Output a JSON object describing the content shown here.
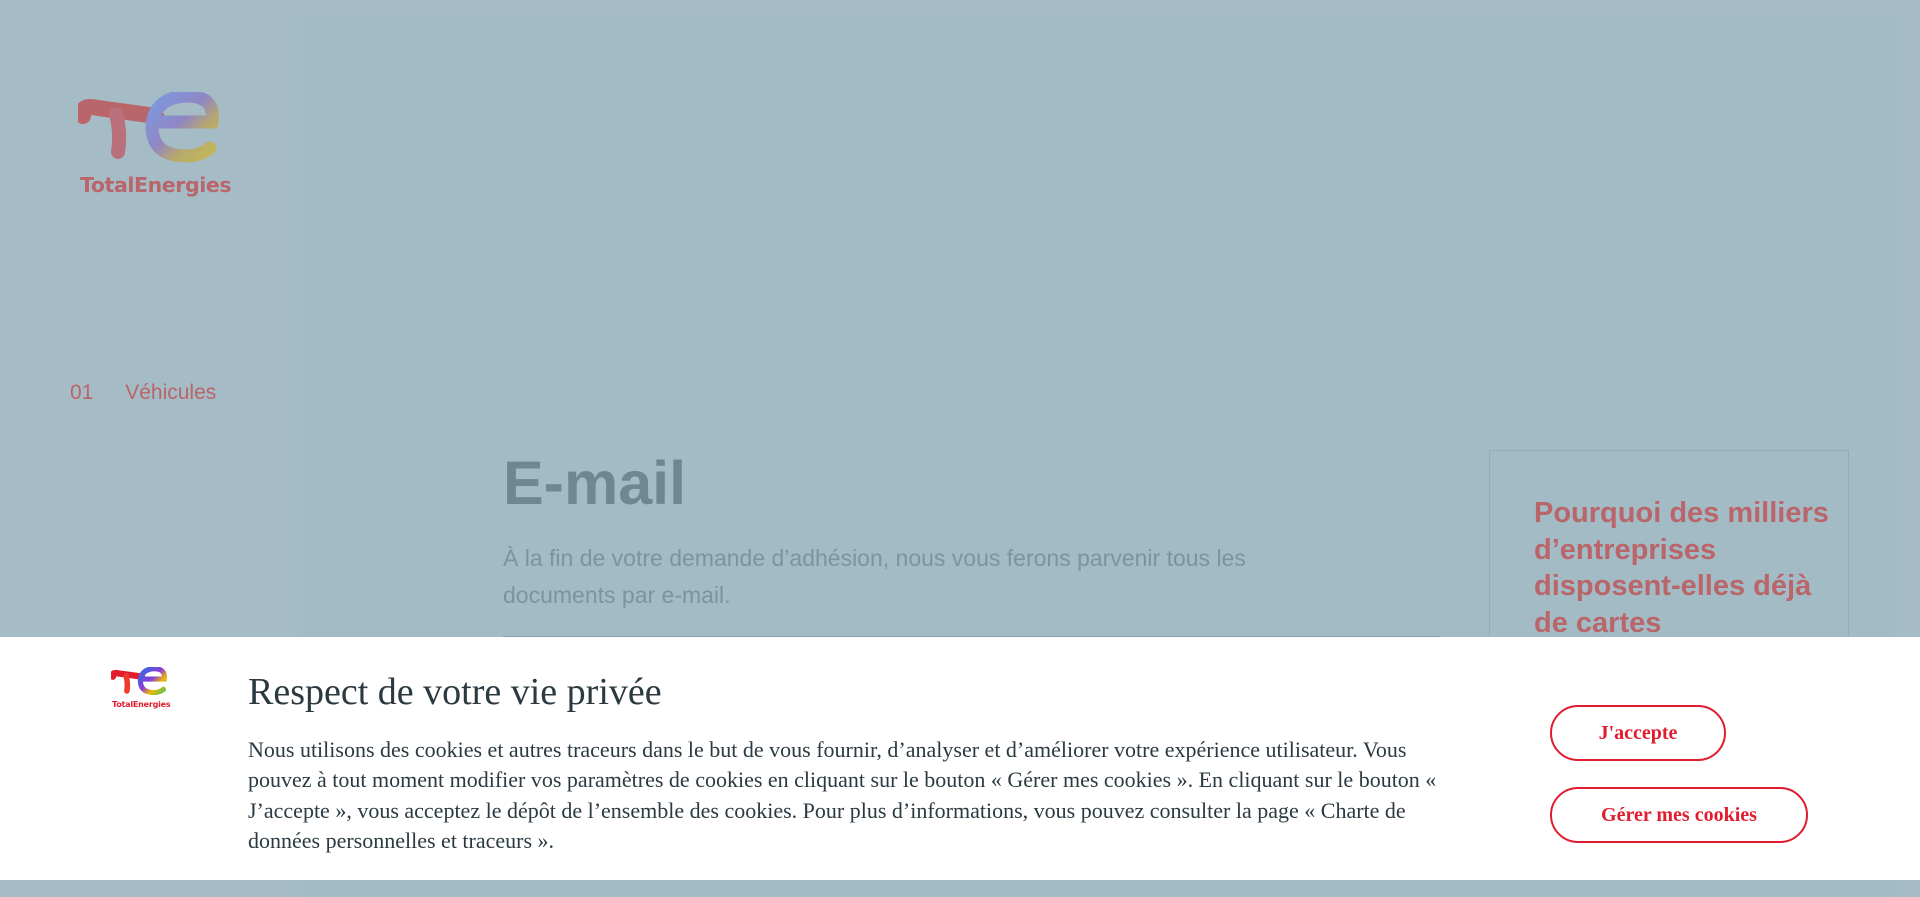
{
  "brand": {
    "name": "TotalEnergies"
  },
  "sidebar": {
    "items": [
      {
        "number": "01",
        "label": "Véhicules"
      }
    ]
  },
  "main": {
    "title": "E-mail",
    "description": "À la fin de votre demande d’adhésion, nous vous ferons parvenir tous les documents par e-mail.",
    "side_box": {
      "title": "Pourquoi des milliers d’entreprises disposent-elles déjà de cartes"
    }
  },
  "cookie_banner": {
    "title": "Respect de votre vie privée",
    "text": "Nous utilisons des cookies et autres traceurs dans le but de vous fournir, d’analyser et d’améliorer votre expérience utilisateur. Vous pouvez à tout moment modifier vos paramètres de cookies en cliquant sur le bouton « Gérer mes cookies ». En cliquant sur le bouton « J’accepte », vous acceptez le dépôt de l’ensemble des cookies. Pour plus d’informations, vous pouvez consulter la page « Charte de données personnelles et traceurs ».",
    "accept_label": "J'accepte",
    "manage_label": "Gérer mes cookies"
  },
  "colors": {
    "brand_red": "#e01c2e",
    "dimmed_brand": "#b9656a",
    "overlay_bg": "#a5bcc6"
  }
}
